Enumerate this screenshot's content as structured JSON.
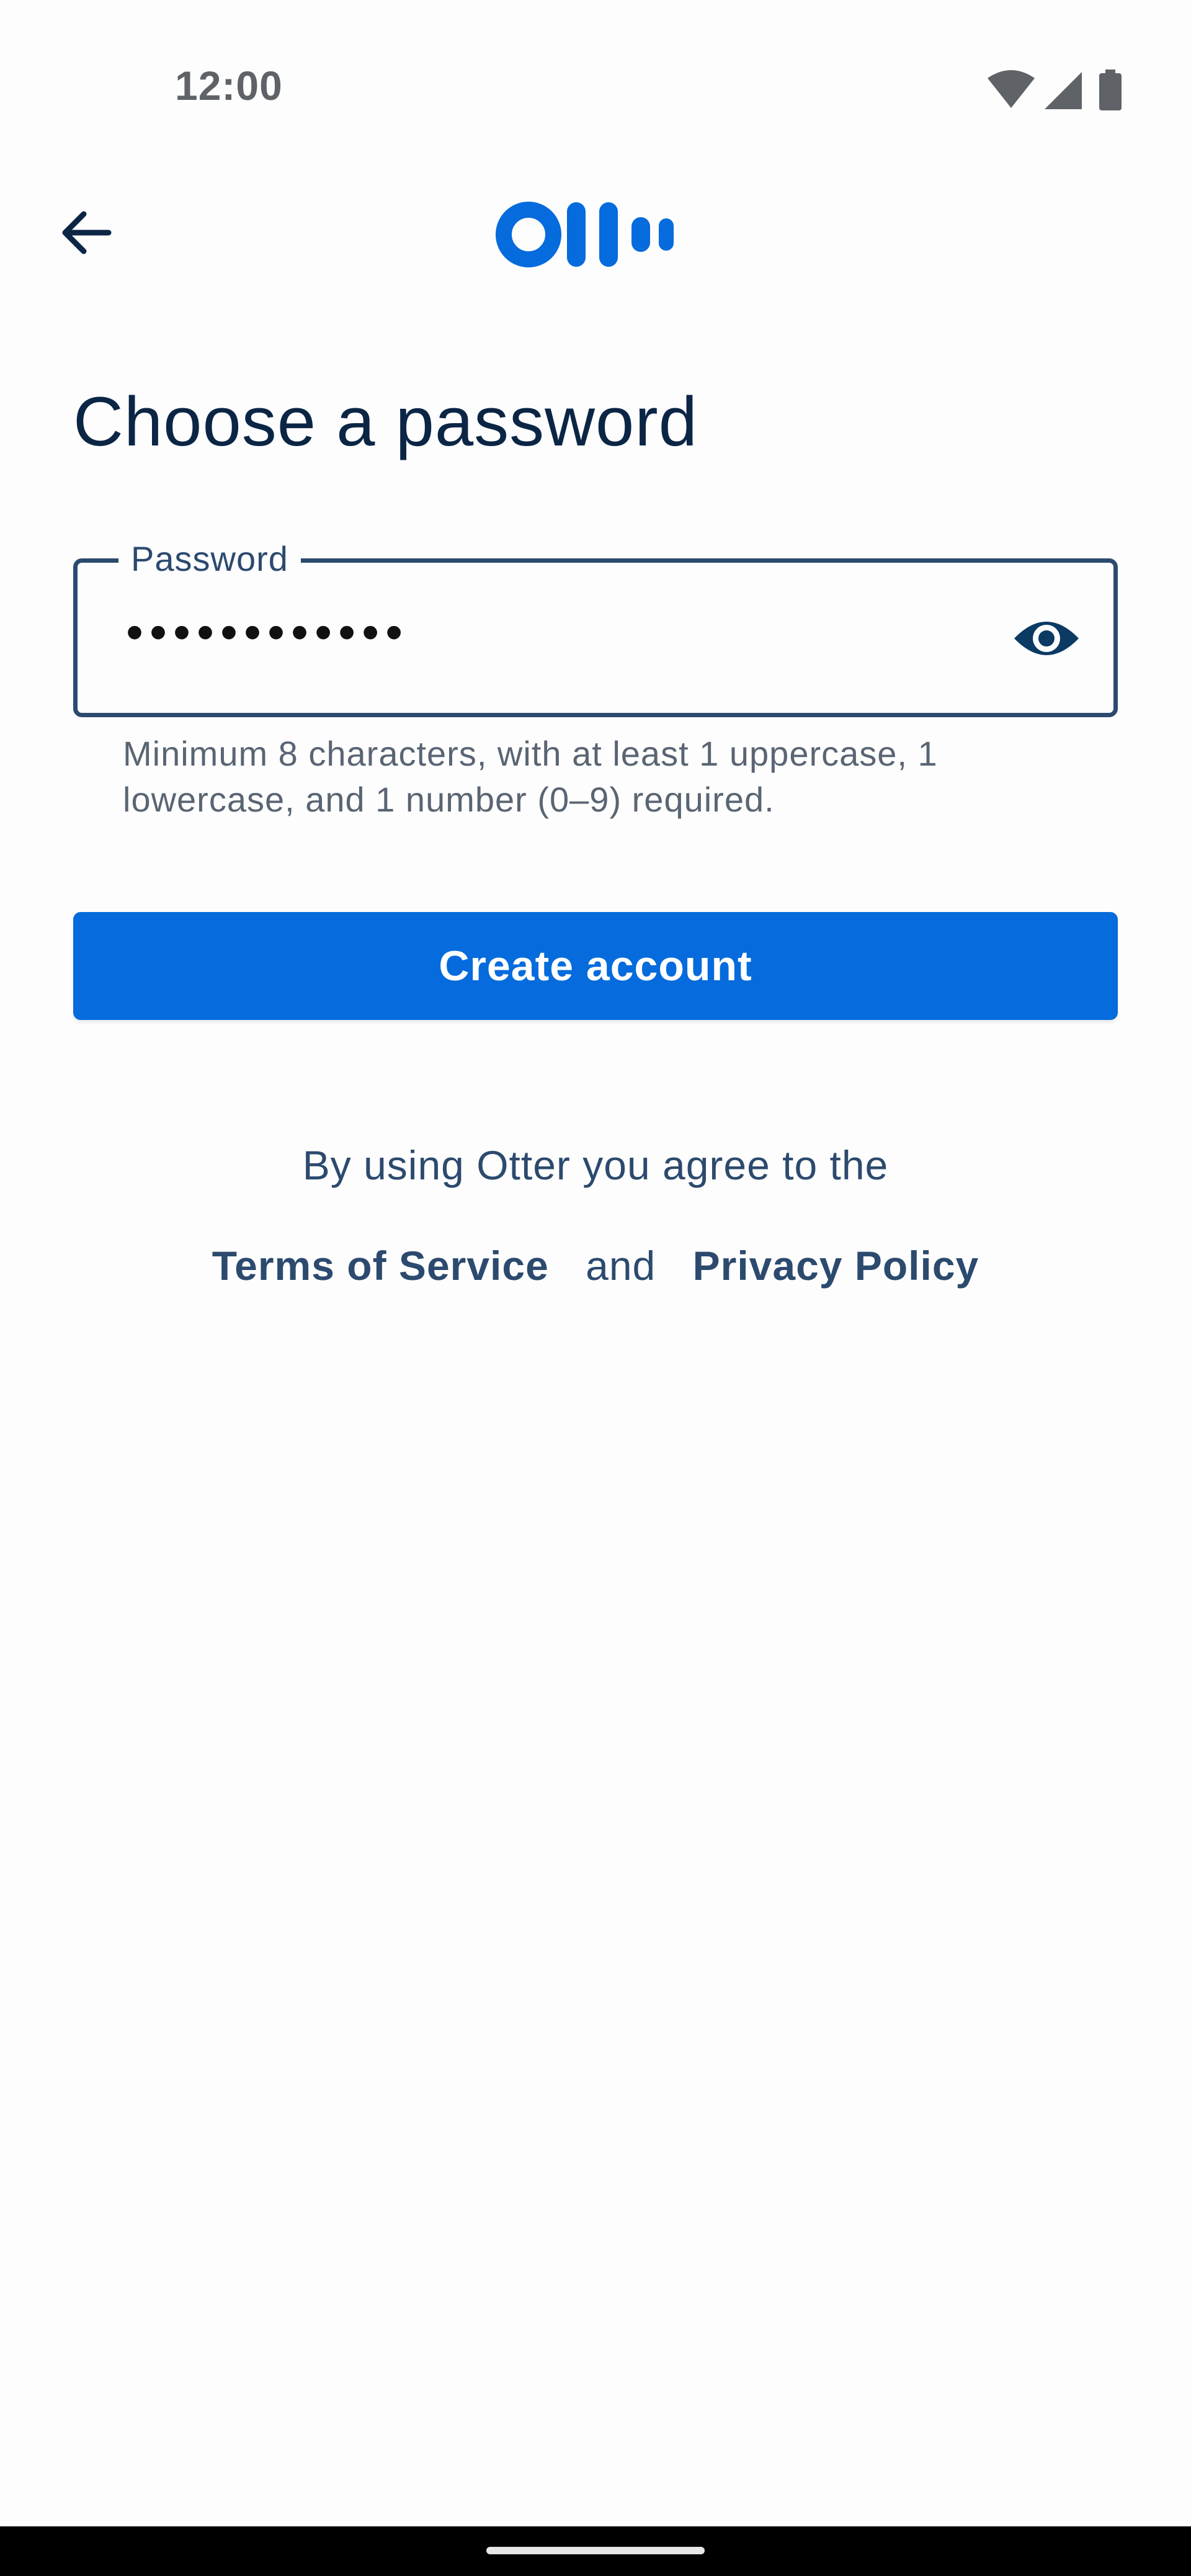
{
  "status_bar": {
    "time": "12:00",
    "icons": [
      "wifi-icon",
      "cellular-signal-icon",
      "battery-icon"
    ]
  },
  "header": {
    "back_icon": "arrow-left-icon",
    "logo_icon": "otter-logo-icon"
  },
  "page": {
    "title": "Choose a password"
  },
  "password_field": {
    "label": "Password",
    "masked_value": "••••••••••••",
    "toggle_icon": "eye-icon",
    "helper": "Minimum 8 characters, with at least 1 uppercase, 1 lowercase, and 1 number (0–9) required."
  },
  "actions": {
    "create_account_label": "Create account"
  },
  "legal": {
    "agree_text": "By using Otter you agree to the",
    "terms_label": "Terms of Service",
    "and_text": "and",
    "privacy_label": "Privacy Policy"
  },
  "colors": {
    "primary": "#066bdc",
    "heading": "#0b2545",
    "text": "#2c4a6e",
    "helper": "#5a6573",
    "background": "#fdfdfd"
  }
}
